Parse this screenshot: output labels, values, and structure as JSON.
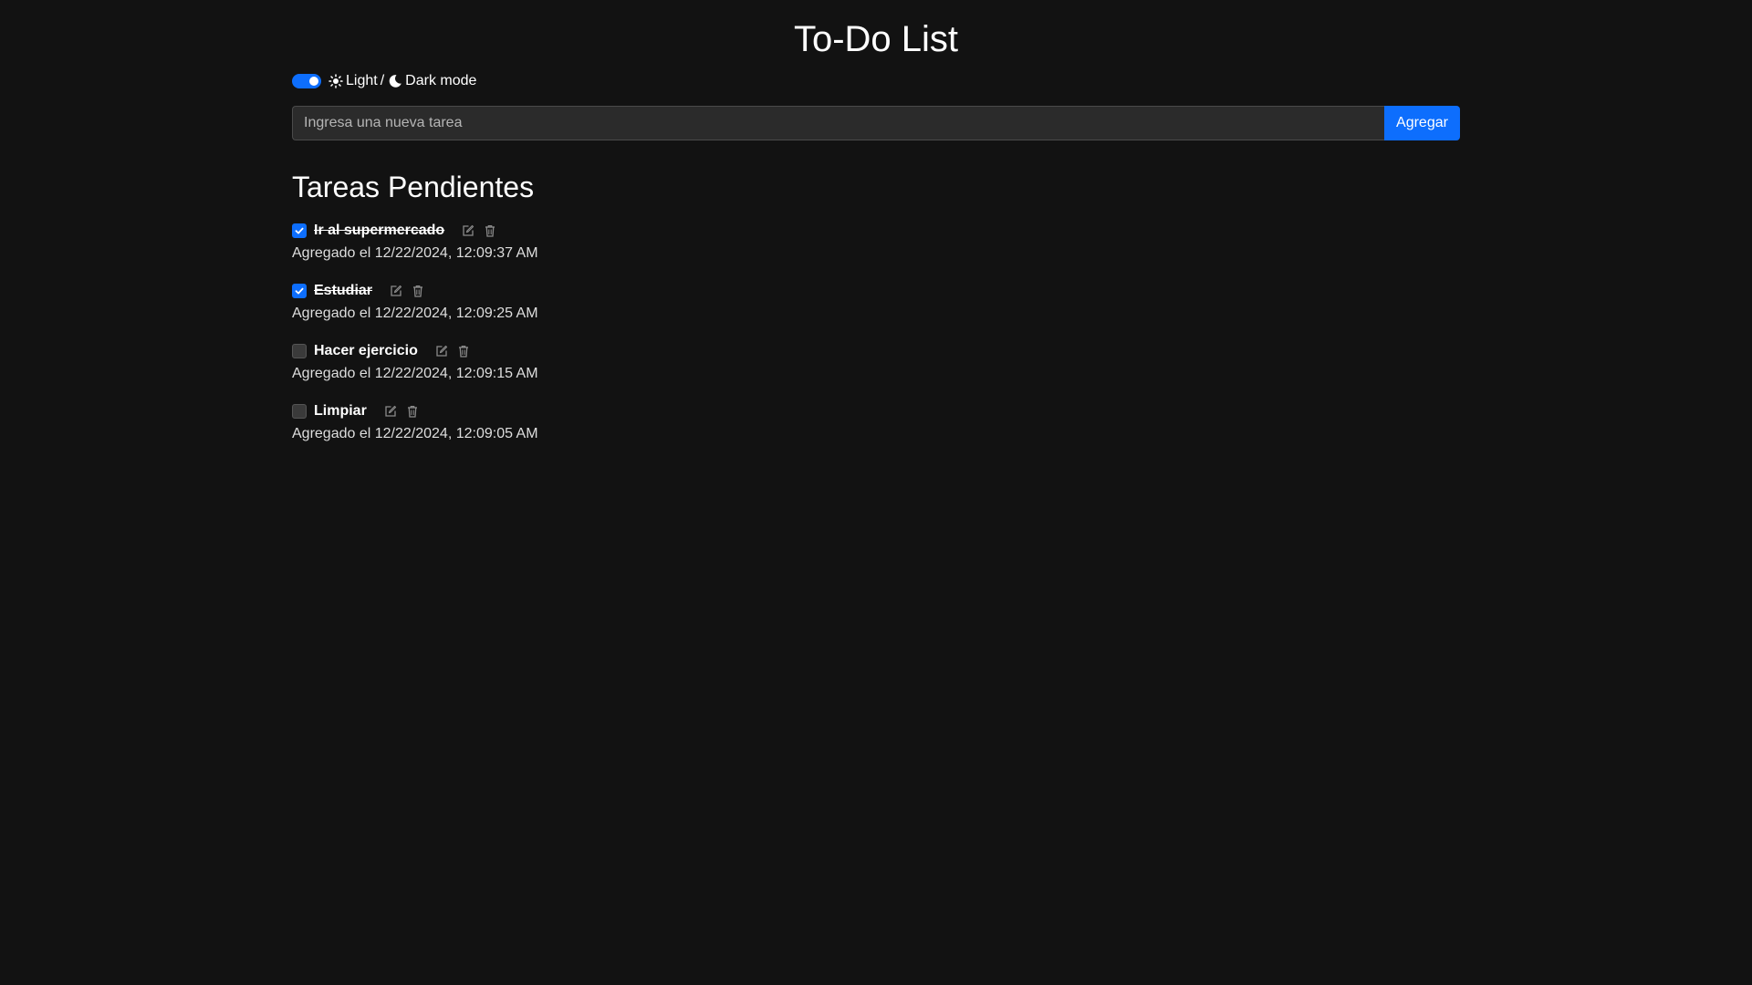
{
  "app": {
    "title": "To-Do List"
  },
  "theme": {
    "light_label": "Light",
    "separator": "/",
    "dark_label": "Dark mode",
    "enabled": true,
    "accent_color": "#0d6efd"
  },
  "new_task": {
    "placeholder": "Ingresa una nueva tarea",
    "value": "",
    "button_label": "Agregar"
  },
  "pending": {
    "title": "Tareas Pendientes",
    "tasks": [
      {
        "name": "Ir al supermercado",
        "completed": true,
        "date": "Agregado el 12/22/2024, 12:09:37 AM"
      },
      {
        "name": "Estudiar",
        "completed": true,
        "date": "Agregado el 12/22/2024, 12:09:25 AM"
      },
      {
        "name": "Hacer ejercicio",
        "completed": false,
        "date": "Agregado el 12/22/2024, 12:09:15 AM"
      },
      {
        "name": "Limpiar",
        "completed": false,
        "date": "Agregado el 12/22/2024, 12:09:05 AM"
      }
    ]
  },
  "icons": {
    "sun": "sun-icon",
    "moon": "moon-icon",
    "edit": "edit-icon",
    "delete": "trash-icon",
    "check": "check-icon"
  }
}
